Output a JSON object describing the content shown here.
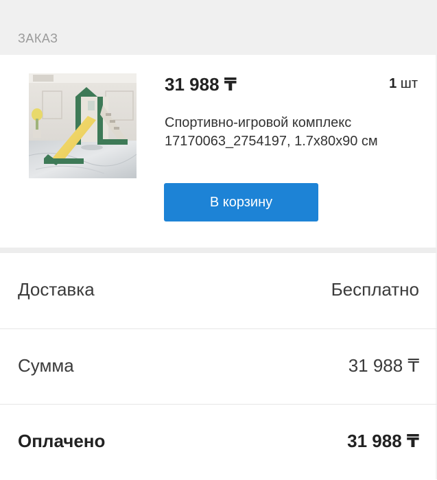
{
  "order_section": {
    "header_label": "ЗАКАЗ"
  },
  "product": {
    "image_icon": "product-photo-slide-playset",
    "price": "31 988 ₸",
    "quantity_number": "1",
    "quantity_unit": "шт",
    "title": "Спортивно-игровой комплекс 17170063_2754197, 1.7x80x90 см",
    "cart_button_label": "В корзину",
    "cart_button_color": "#1d83d6"
  },
  "summary": {
    "delivery_label": "Доставка",
    "delivery_value": "Бесплатно",
    "sum_label": "Сумма",
    "sum_value": "31 988 ₸",
    "paid_label": "Оплачено",
    "paid_value": "31 988 ₸"
  }
}
